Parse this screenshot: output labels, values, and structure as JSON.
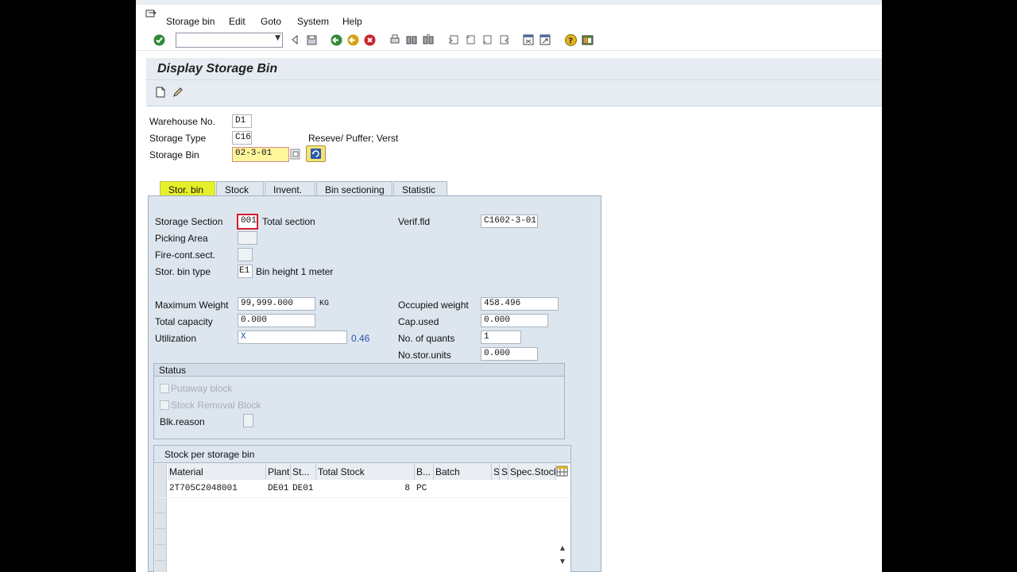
{
  "menu": {
    "items": [
      "Storage bin",
      "Edit",
      "Goto",
      "System",
      "Help"
    ]
  },
  "toolbar": {
    "command_field_value": ""
  },
  "page": {
    "title": "Display Storage Bin"
  },
  "header_fields": {
    "warehouse_label": "Warehouse No.",
    "warehouse_value": "D1",
    "storage_type_label": "Storage Type",
    "storage_type_value": "C16",
    "storage_type_desc": "Reseve/ Puffer; Verst",
    "storage_bin_label": "Storage Bin",
    "storage_bin_value": "02-3-01"
  },
  "tabs": [
    "Stor. bin",
    "Stock",
    "Invent.",
    "Bin sectioning",
    "Statistic"
  ],
  "stor_bin_tab": {
    "storage_section_label": "Storage Section",
    "storage_section_value": "001",
    "storage_section_desc": "Total section",
    "picking_area_label": "Picking Area",
    "picking_area_value": "",
    "fire_cont_label": "Fire-cont.sect.",
    "fire_cont_value": "",
    "bin_type_label": "Stor. bin type",
    "bin_type_value": "E1",
    "bin_type_desc": "Bin height 1 meter",
    "verif_label": "Verif.fld",
    "verif_value": "C1602-3-01",
    "max_weight_label": "Maximum Weight",
    "max_weight_value": "99,999.000",
    "weight_unit": "KG",
    "total_capacity_label": "Total capacity",
    "total_capacity_value": "0.000",
    "utilization_label": "Utilization",
    "utilization_value": "X",
    "utilization_pct": "0.46",
    "occupied_weight_label": "Occupied weight",
    "occupied_weight_value": "458.496",
    "cap_used_label": "Cap.used",
    "cap_used_value": "0.000",
    "no_quants_label": "No. of quants",
    "no_quants_value": "1",
    "no_stor_units_label": "No.stor.units",
    "no_stor_units_value": "0.000"
  },
  "status_group": {
    "title": "Status",
    "putaway_block_label": "Putaway block",
    "stock_removal_block_label": "Stock Removal Block",
    "blk_reason_label": "Blk.reason",
    "blk_reason_value": ""
  },
  "stock_table": {
    "title": "Stock per storage bin",
    "columns": [
      "Material",
      "Plant",
      "St...",
      "Total Stock",
      "B...",
      "Batch",
      "S",
      "S",
      "Spec.Stock"
    ],
    "rows": [
      {
        "material": "2T705C2048001",
        "plant": "DE01",
        "storage_loc": "DE01",
        "total_stock": "8",
        "unit": "PC",
        "batch": "",
        "s1": "",
        "s2": "",
        "spec_stock": ""
      }
    ]
  },
  "colors": {
    "active_tab_highlight": "#e6f02a",
    "required_field_outline": "#d21f2f",
    "utilization_pct_color": "#2a52a8",
    "panel_bg": "#dde6ef"
  }
}
